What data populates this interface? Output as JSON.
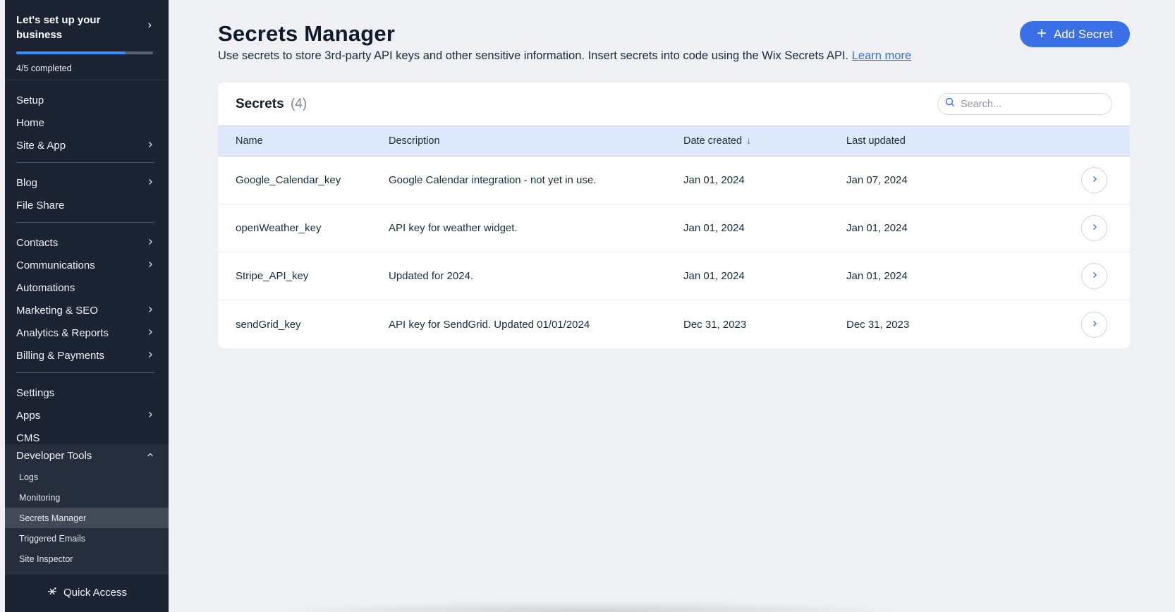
{
  "sidebar": {
    "setup": {
      "title": "Let's set up your business",
      "progress_fraction": 0.8,
      "progress_text": "4/5 completed"
    },
    "groups": [
      [
        {
          "label": "Setup",
          "chevron": false
        },
        {
          "label": "Home",
          "chevron": false
        },
        {
          "label": "Site & App",
          "chevron": true
        }
      ],
      [
        {
          "label": "Blog",
          "chevron": true
        },
        {
          "label": "File Share",
          "chevron": false
        }
      ],
      [
        {
          "label": "Contacts",
          "chevron": true
        },
        {
          "label": "Communications",
          "chevron": true
        },
        {
          "label": "Automations",
          "chevron": false
        },
        {
          "label": "Marketing & SEO",
          "chevron": true
        },
        {
          "label": "Analytics & Reports",
          "chevron": true
        },
        {
          "label": "Billing & Payments",
          "chevron": true
        }
      ],
      [
        {
          "label": "Settings",
          "chevron": false
        },
        {
          "label": "Apps",
          "chevron": true
        },
        {
          "label": "CMS",
          "chevron": false
        }
      ]
    ],
    "developer_tools": {
      "label": "Developer Tools",
      "items": [
        "Logs",
        "Monitoring",
        "Secrets Manager",
        "Triggered Emails",
        "Site Inspector"
      ],
      "active": "Secrets Manager"
    },
    "quick_access": "Quick Access"
  },
  "header": {
    "title": "Secrets Manager",
    "subtitle": "Use secrets to store 3rd-party API keys and other sensitive information. Insert secrets into code using the Wix Secrets API.",
    "learn_more": "Learn more",
    "add_button": "Add Secret"
  },
  "table": {
    "title": "Secrets",
    "count": "(4)",
    "search_placeholder": "Search...",
    "columns": {
      "name": "Name",
      "description": "Description",
      "date_created": "Date created",
      "last_updated": "Last updated"
    },
    "rows": [
      {
        "name": "Google_Calendar_key",
        "description": "Google Calendar integration - not yet in use.",
        "date_created": "Jan 01, 2024",
        "last_updated": "Jan 07, 2024"
      },
      {
        "name": "openWeather_key",
        "description": "API key for weather widget.",
        "date_created": "Jan 01, 2024",
        "last_updated": "Jan 01, 2024"
      },
      {
        "name": "Stripe_API_key",
        "description": "Updated for 2024.",
        "date_created": "Jan 01, 2024",
        "last_updated": "Jan 01, 2024"
      },
      {
        "name": "sendGrid_key",
        "description": "API key for SendGrid. Updated 01/01/2024",
        "date_created": "Dec 31, 2023",
        "last_updated": "Dec 31, 2023"
      }
    ]
  },
  "colors": {
    "accent": "#3b6fe6",
    "sidebar_bg": "#1c2433",
    "table_header_bg": "#dde8fb"
  }
}
